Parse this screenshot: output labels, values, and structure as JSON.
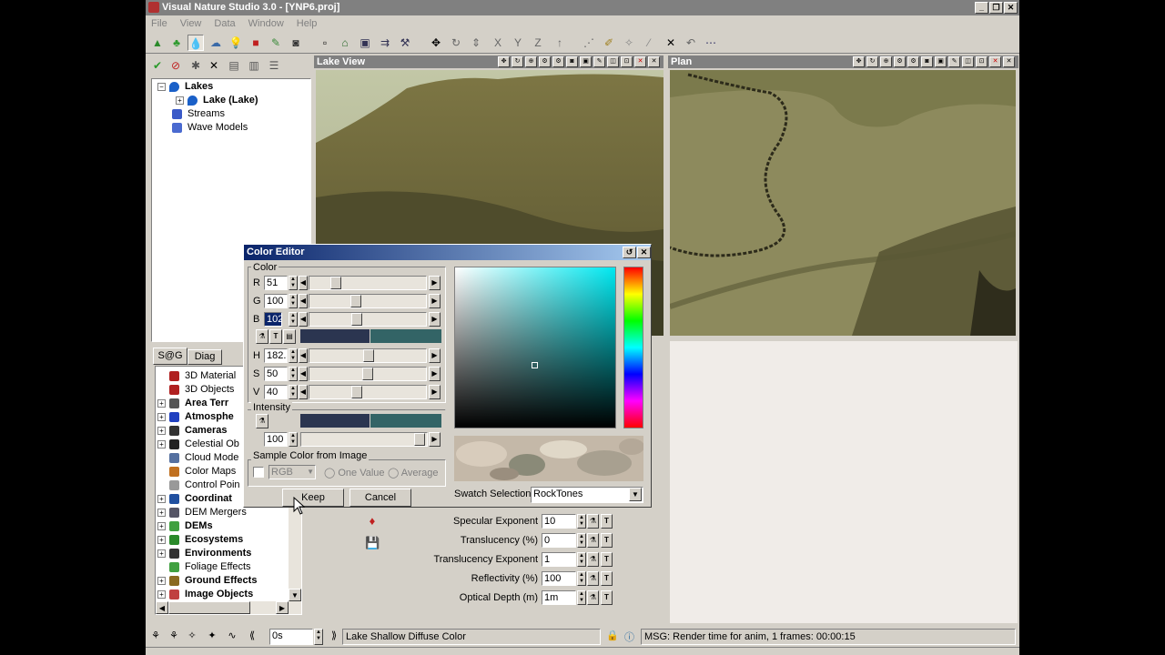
{
  "window": {
    "title": "Visual Nature Studio 3.0  - [YNP6.proj]"
  },
  "menu": [
    "File",
    "View",
    "Data",
    "Window",
    "Help"
  ],
  "tree": {
    "root": "Lakes",
    "child": "Lake (Lake)",
    "items": [
      "Streams",
      "Wave Models"
    ]
  },
  "sg_tabs": [
    "S@G",
    "Diag"
  ],
  "sg_list": [
    {
      "label": "3D Material",
      "bold": false
    },
    {
      "label": "3D Objects",
      "bold": false
    },
    {
      "label": "Area Terr",
      "bold": true
    },
    {
      "label": "Atmosphe",
      "bold": true
    },
    {
      "label": "Cameras",
      "bold": true
    },
    {
      "label": "Celestial Ob",
      "bold": false
    },
    {
      "label": "Cloud Mode",
      "bold": false
    },
    {
      "label": "Color Maps",
      "bold": false
    },
    {
      "label": "Control Poin",
      "bold": false
    },
    {
      "label": "Coordinat",
      "bold": true
    },
    {
      "label": "DEM Mergers",
      "bold": false
    },
    {
      "label": "DEMs",
      "bold": true
    },
    {
      "label": "Ecosystems",
      "bold": true
    },
    {
      "label": "Environments",
      "bold": true
    },
    {
      "label": "Foliage Effects",
      "bold": false
    },
    {
      "label": "Ground Effects",
      "bold": true
    },
    {
      "label": "Image Objects",
      "bold": true
    }
  ],
  "views": {
    "lake": "Lake View",
    "plan": "Plan"
  },
  "color_editor": {
    "title": "Color Editor",
    "color_group": "Color",
    "r": {
      "label": "R",
      "value": "51",
      "level": 0.2
    },
    "g": {
      "label": "G",
      "value": "100",
      "level": 0.39
    },
    "b": {
      "label": "B",
      "value": "102",
      "level": 0.4
    },
    "h": {
      "label": "H",
      "value": "182.3",
      "level": 0.51
    },
    "s": {
      "label": "S",
      "value": "50",
      "level": 0.5
    },
    "v": {
      "label": "V",
      "value": "40",
      "level": 0.4
    },
    "intensity_label": "Intensity",
    "intensity_value": "100",
    "sample_group": "Sample Color from Image",
    "sample_mode": "RGB",
    "one_value": "One Value",
    "average": "Average",
    "swatch_label": "Swatch Selection",
    "swatch_value": "RockTones",
    "keep": "Keep",
    "cancel": "Cancel",
    "old_color": "#2b3550",
    "new_color": "#336466"
  },
  "properties": [
    {
      "label": "Specular Exponent",
      "value": "10"
    },
    {
      "label": "Translucency (%)",
      "value": "0"
    },
    {
      "label": "Translucency Exponent",
      "value": "1"
    },
    {
      "label": "Reflectivity (%)",
      "value": "100"
    },
    {
      "label": "Optical Depth (m)",
      "value": "1m"
    }
  ],
  "status": {
    "time_value": "0s",
    "parameter": "Lake Shallow Diffuse Color",
    "message": "MSG: Render time for anim, 1 frames:  00:00:15"
  }
}
